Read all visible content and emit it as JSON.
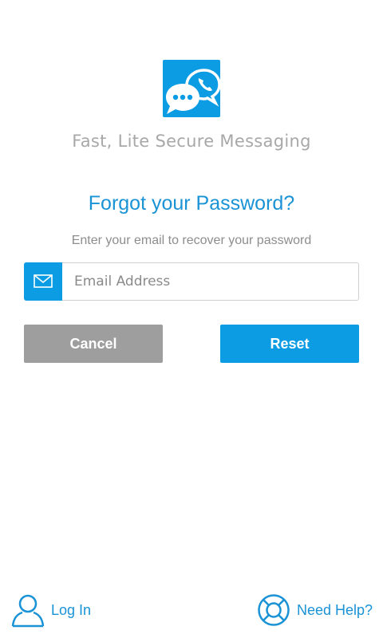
{
  "brand": {
    "logo_icon": "chat-bubbles-phone-icon",
    "tagline": "Fast, Lite Secure Messaging",
    "accent_color": "#0b9ce3"
  },
  "form": {
    "title": "Forgot your Password?",
    "subtitle": "Enter your email to recover your password",
    "email_icon": "envelope-icon",
    "email_placeholder": "Email Address",
    "email_value": ""
  },
  "buttons": {
    "cancel_label": "Cancel",
    "reset_label": "Reset"
  },
  "footer": {
    "login_icon": "user-icon",
    "login_label": "Log In",
    "help_icon": "lifebuoy-icon",
    "help_label": "Need Help?"
  }
}
